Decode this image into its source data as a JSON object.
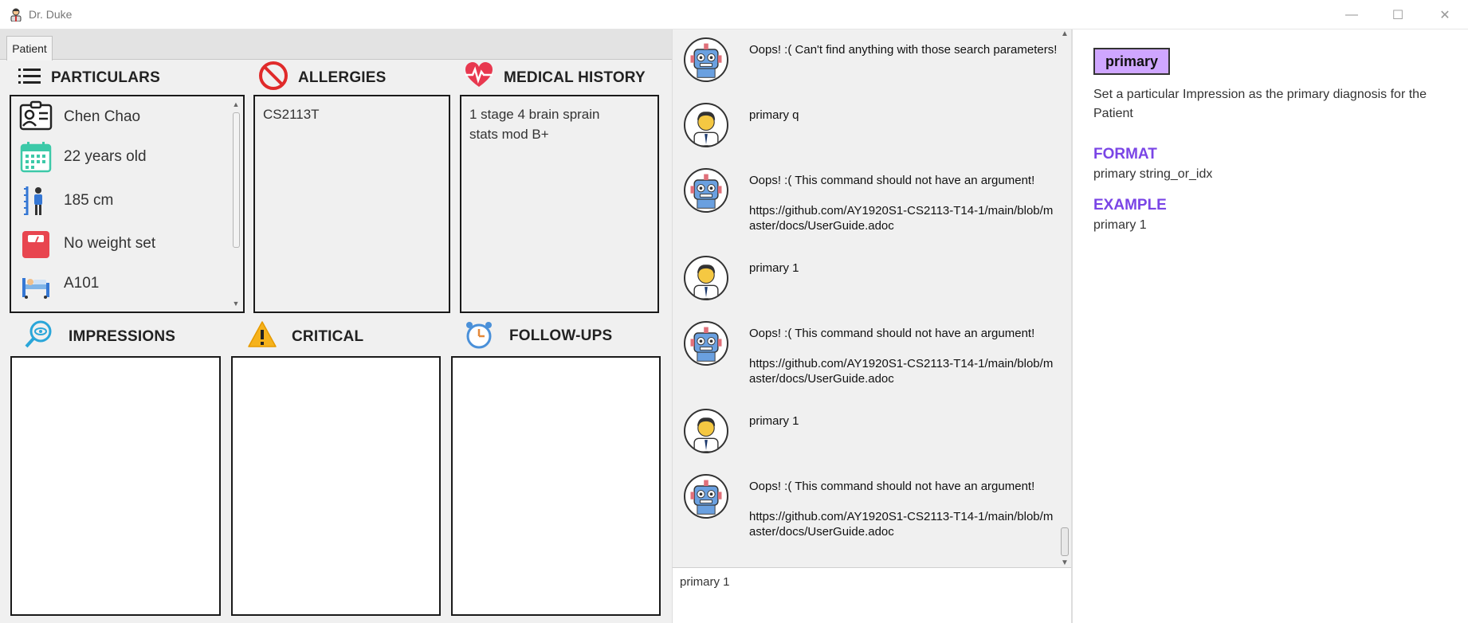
{
  "window": {
    "title": "Dr. Duke",
    "minimize": "—",
    "maximize": "☐",
    "close": "✕"
  },
  "tabs": [
    {
      "label": "Patient"
    }
  ],
  "patient": {
    "sections": {
      "particulars": "PARTICULARS",
      "allergies": "ALLERGIES",
      "medical_history": "MEDICAL HISTORY",
      "impressions": "IMPRESSIONS",
      "critical": "CRITICAL",
      "followups": "FOLLOW-UPS"
    },
    "particulars": {
      "name": "Chen Chao",
      "age": "22 years old",
      "height": "185 cm",
      "weight": "No weight set",
      "bed": "A101"
    },
    "allergies": [
      "CS2113T"
    ],
    "medical_history": [
      "1 stage 4 brain sprain",
      "stats mod B+"
    ]
  },
  "chat": {
    "messages": [
      {
        "sender": "bot",
        "lines": [
          "Oops! :( Can't find anything with those search parameters!"
        ]
      },
      {
        "sender": "user",
        "lines": [
          "primary q"
        ]
      },
      {
        "sender": "bot",
        "lines": [
          "Oops! :( This command should not have an argument!",
          "",
          "https://github.com/AY1920S1-CS2113-T14-1/main/blob/m",
          "aster/docs/UserGuide.adoc"
        ]
      },
      {
        "sender": "user",
        "lines": [
          "primary 1"
        ]
      },
      {
        "sender": "bot",
        "lines": [
          "Oops! :( This command should not have an argument!",
          "",
          "https://github.com/AY1920S1-CS2113-T14-1/main/blob/m",
          "aster/docs/UserGuide.adoc"
        ]
      },
      {
        "sender": "user",
        "lines": [
          "primary 1"
        ]
      },
      {
        "sender": "bot",
        "lines": [
          "Oops! :( This command should not have an argument!",
          "",
          "https://github.com/AY1920S1-CS2113-T14-1/main/blob/m",
          "aster/docs/UserGuide.adoc"
        ]
      }
    ],
    "input_value": "primary 1"
  },
  "help": {
    "command": "primary",
    "description": "Set a particular Impression as the primary diagnosis for the Patient",
    "format_heading": "FORMAT",
    "format_value": "primary string_or_idx",
    "example_heading": "EXAMPLE",
    "example_value": "primary 1",
    "accent_color": "#7a45e6",
    "badge_color": "#cfa6ff"
  }
}
